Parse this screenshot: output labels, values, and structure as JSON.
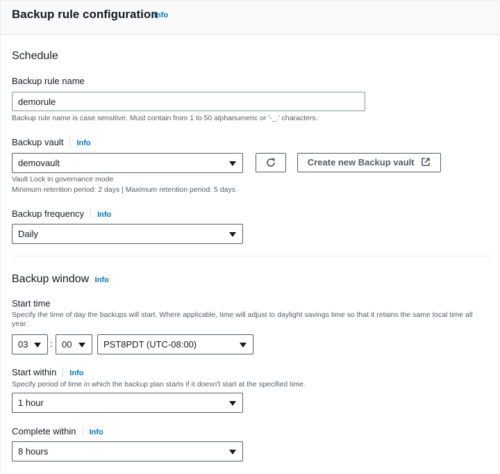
{
  "header": {
    "title": "Backup rule configuration",
    "info": "Info"
  },
  "schedule": {
    "title": "Schedule",
    "rule_name": {
      "label": "Backup rule name",
      "value": "demorule",
      "hint": "Backup rule name is case sensitive. Must contain from 1 to 50 alphanumeric or '-_.' characters."
    },
    "vault": {
      "label": "Backup vault",
      "info": "Info",
      "value": "demovault",
      "refresh_icon": "refresh-icon",
      "create_button": "Create new Backup vault",
      "external_icon": "external-link-icon",
      "hint_line1": "Vault Lock in governance mode",
      "hint_line2": "Minimum retention period: 2 days | Maximum retention period: 5 days"
    },
    "frequency": {
      "label": "Backup frequency",
      "info": "Info",
      "value": "Daily"
    }
  },
  "window": {
    "title": "Backup window",
    "info": "Info",
    "start_time": {
      "label": "Start time",
      "hint": "Specify the time of day the backups will start. Where applicable, time will adjust to daylight savings time so that it retains the same local time all year.",
      "hour": "03",
      "separator": ":",
      "minute": "00",
      "timezone": "PST8PDT (UTC-08:00)"
    },
    "start_within": {
      "label": "Start within",
      "info": "Info",
      "hint": "Specify period of time in which the backup plan starts if it doesn't start at the specified time.",
      "value": "1 hour"
    },
    "complete_within": {
      "label": "Complete within",
      "info": "Info",
      "value": "8 hours"
    }
  }
}
